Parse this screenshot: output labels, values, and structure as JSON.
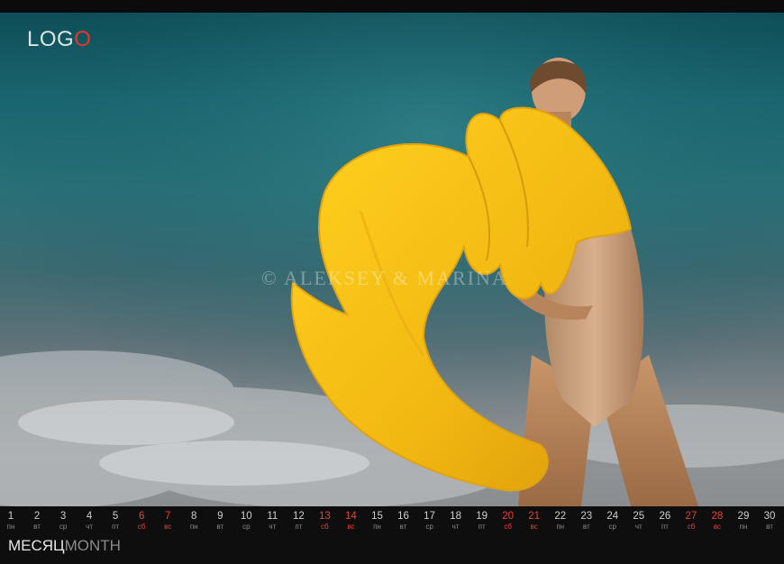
{
  "logo": {
    "main": "LOG",
    "accent": "O"
  },
  "watermark": "© ALEKSEY & MARINA",
  "month": {
    "ru": "МЕСЯЦ",
    "en": "MONTH"
  },
  "colors": {
    "accent": "#e8342a",
    "weekend": "#e8403a",
    "sky": "#1a6771",
    "coat": "#f2c020"
  },
  "days": [
    {
      "n": "1",
      "w": "пн",
      "weekend": false
    },
    {
      "n": "2",
      "w": "вт",
      "weekend": false
    },
    {
      "n": "3",
      "w": "ср",
      "weekend": false
    },
    {
      "n": "4",
      "w": "чт",
      "weekend": false
    },
    {
      "n": "5",
      "w": "пт",
      "weekend": false
    },
    {
      "n": "6",
      "w": "сб",
      "weekend": true
    },
    {
      "n": "7",
      "w": "вс",
      "weekend": true
    },
    {
      "n": "8",
      "w": "пн",
      "weekend": false
    },
    {
      "n": "9",
      "w": "вт",
      "weekend": false
    },
    {
      "n": "10",
      "w": "ср",
      "weekend": false
    },
    {
      "n": "11",
      "w": "чт",
      "weekend": false
    },
    {
      "n": "12",
      "w": "пт",
      "weekend": false
    },
    {
      "n": "13",
      "w": "сб",
      "weekend": true
    },
    {
      "n": "14",
      "w": "вс",
      "weekend": true
    },
    {
      "n": "15",
      "w": "пн",
      "weekend": false
    },
    {
      "n": "16",
      "w": "вт",
      "weekend": false
    },
    {
      "n": "17",
      "w": "ср",
      "weekend": false
    },
    {
      "n": "18",
      "w": "чт",
      "weekend": false
    },
    {
      "n": "19",
      "w": "пт",
      "weekend": false
    },
    {
      "n": "20",
      "w": "сб",
      "weekend": true
    },
    {
      "n": "21",
      "w": "вс",
      "weekend": true
    },
    {
      "n": "22",
      "w": "пн",
      "weekend": false
    },
    {
      "n": "23",
      "w": "вт",
      "weekend": false
    },
    {
      "n": "24",
      "w": "ср",
      "weekend": false
    },
    {
      "n": "25",
      "w": "чт",
      "weekend": false
    },
    {
      "n": "26",
      "w": "пт",
      "weekend": false
    },
    {
      "n": "27",
      "w": "сб",
      "weekend": true
    },
    {
      "n": "28",
      "w": "вс",
      "weekend": true
    },
    {
      "n": "29",
      "w": "пн",
      "weekend": false
    },
    {
      "n": "30",
      "w": "вт",
      "weekend": false
    }
  ]
}
